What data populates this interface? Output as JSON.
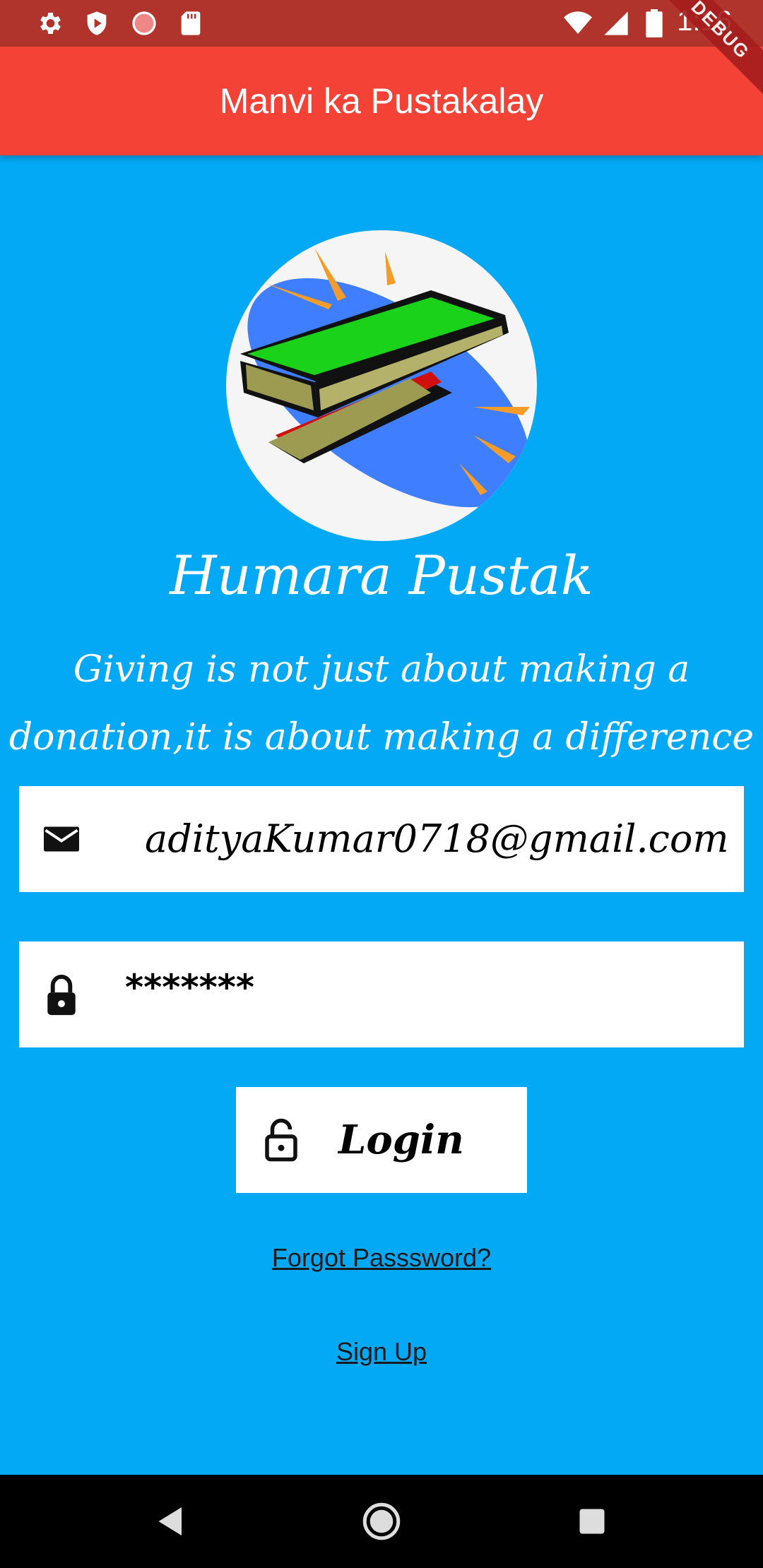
{
  "status_bar": {
    "time": "1:16",
    "icons": [
      "settings-icon",
      "shield-play-icon",
      "sync-icon",
      "sd-card-icon",
      "wifi-icon",
      "signal-icon",
      "battery-icon"
    ]
  },
  "app_bar": {
    "title": "Manvi ka Pustakalay",
    "debug_banner": "DEBUG"
  },
  "brand": {
    "name": "Humara Pustak"
  },
  "tagline": "Giving is not just about making a donation,it is about making a difference",
  "form": {
    "email_value": "adityaKumar0718@gmail.com",
    "password_value": "*******",
    "login_label": "Login"
  },
  "links": {
    "forgot_password": "Forgot Passsword?",
    "sign_up": "Sign Up"
  },
  "colors": {
    "background": "#03A9F4",
    "app_bar": "#F44336",
    "status_bar": "#B0342C",
    "nav_bar": "#000000"
  }
}
